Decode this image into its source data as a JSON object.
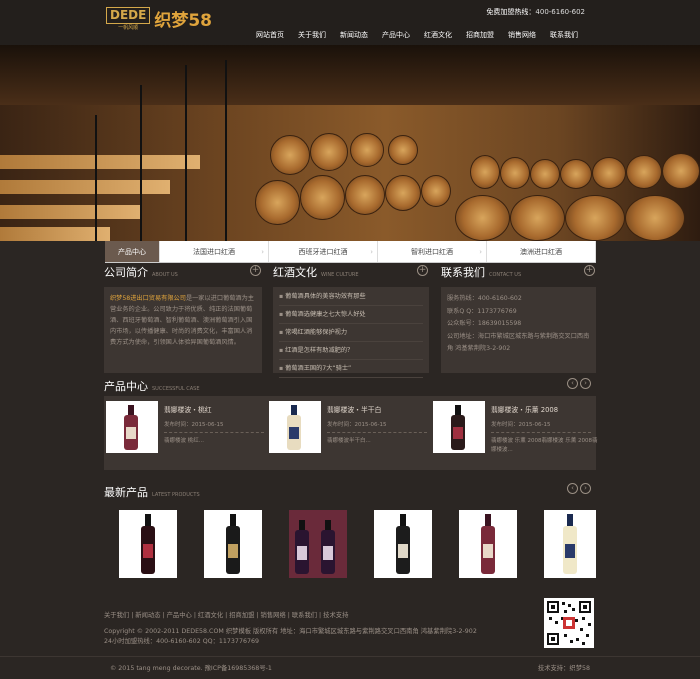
{
  "header": {
    "logo_main": "DEDE",
    "logo_sub": "一帆风顺",
    "logo_cn": "织梦58",
    "hotline_label": "免费加盟热线：",
    "hotline_number": "400-6160-602",
    "nav": [
      "网站首页",
      "关于我们",
      "新闻动态",
      "产品中心",
      "红酒文化",
      "招商加盟",
      "销售网络",
      "联系我们"
    ]
  },
  "tabs": [
    "产品中心",
    "法国进口红酒",
    "西班牙进口红酒",
    "智利进口红酒",
    "澳洲进口红酒"
  ],
  "about": {
    "title": "公司简介",
    "en": "ABOUT US",
    "highlight": "织梦58进出口贸易有限公司",
    "text": "是一家以进口葡萄酒为主营业务的企业。公司致力于将优质、纯正的法国葡萄酒、西班牙葡萄酒、智利葡萄酒、澳洲葡萄酒引入国内市场，以传播健康、时尚的消费文化，丰富国人消费方式为使命，引领国人体验异国葡萄酒风情。"
  },
  "culture": {
    "title": "红酒文化",
    "en": "WINE CULTURE",
    "items": [
      "葡萄酒具体的美容功效有那些",
      "葡萄酒选健康之七大惊人好处",
      "常喝红酒能够保护视力",
      "红酒是怎样有助减肥的？",
      "葡萄酒王国的7大“骑士”"
    ]
  },
  "contact": {
    "title": "联系我们",
    "en": "CONTACT US",
    "lines": [
      "服务热线：400-6160-602",
      "联系Q Q：1173776769",
      "公众账号：18639015598",
      "公司地址：海口市繁城区城东路与紫荆路交叉口西南角 鸿基紫荆院3-2-902"
    ]
  },
  "products": {
    "title": "产品中心",
    "en": "SUCCESSFUL CASE",
    "items": [
      {
        "name": "翡娜楼波・桃红",
        "date": "发布时间：2015-06-15",
        "desc": "翡娜楼波 桃红..."
      },
      {
        "name": "翡娜楼波・半干白",
        "date": "发布时间：2015-06-15",
        "desc": "翡娜楼波半干白..."
      },
      {
        "name": "翡娜楼波・乐薰 2008",
        "date": "发布时间：2015-06-15",
        "desc": "翡娜楼波 乐薰 2008翡娜楼波 乐薰 2008翡娜楼波..."
      }
    ]
  },
  "latest": {
    "title": "最新产品",
    "en": "LATEST PRODUCTS"
  },
  "footer": {
    "links": "关于我们 | 新闻动态 | 产品中心 | 红酒文化 | 招商加盟 | 销售网络 | 联系我们 | 技术支持",
    "copy1": "Copyright © 2002-2011 DEDE58.COM 织梦模板 版权所有 地址：海口市繁城区城东路与紫荆路交叉口西南角 鸿基紫荆院3-2-902",
    "copy2": "24小时加盟热线：400-6160-602 QQ：1173776769",
    "bottom_left": "© 2015 tang meng decorate. 豫ICP备16985368号-1",
    "bottom_right": "技术支持：织梦58"
  }
}
